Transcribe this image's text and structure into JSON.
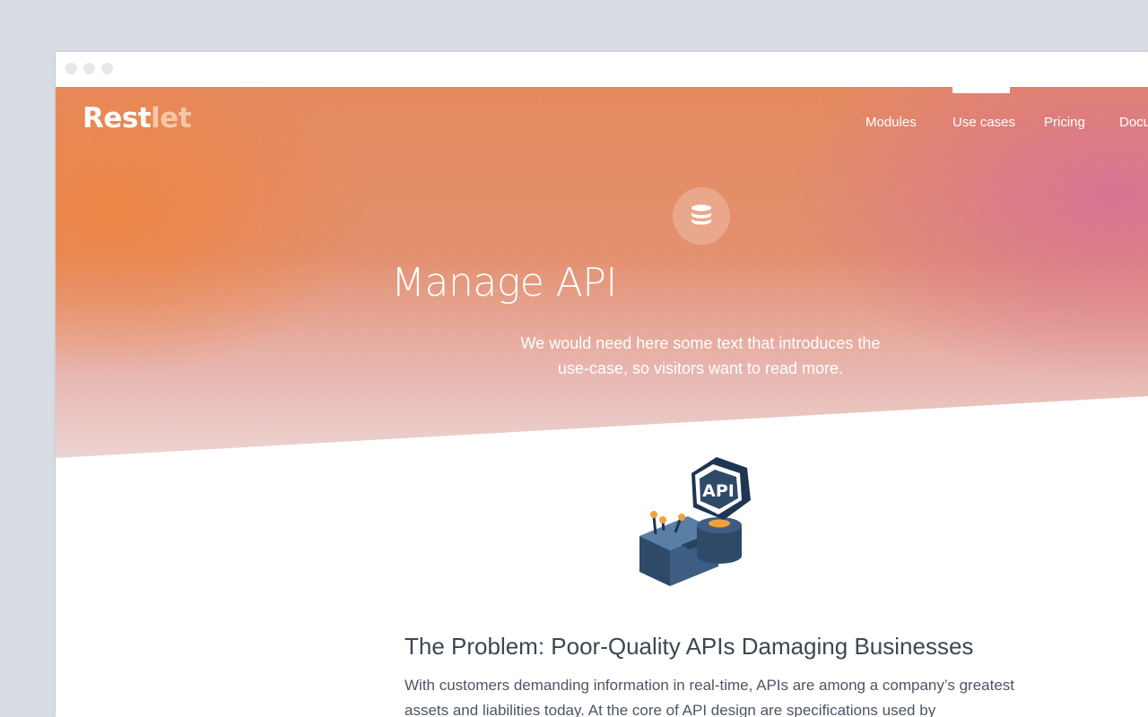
{
  "brand": {
    "logo_main": "Rest",
    "logo_tail": "let"
  },
  "nav": {
    "items": [
      {
        "label": "Modules"
      },
      {
        "label": "Use cases",
        "active": true
      },
      {
        "label": "Pricing"
      },
      {
        "label": "Docu"
      }
    ]
  },
  "hero": {
    "icon": "database-icon",
    "title": "Manage API",
    "subtitle": "We would need here some text that introduces the use-case, so visitors want to read more."
  },
  "illustration": {
    "badge_text": "API"
  },
  "section": {
    "heading": "The Problem: Poor-Quality APIs Damaging Businesses",
    "body": "With customers demanding information in real-time, APIs are among a company’s greatest assets and liabilities today. At the core of API design are specifications used by"
  },
  "colors": {
    "hero_orange": "#ee8440",
    "hero_pink": "#d87296",
    "heading": "#3c4754",
    "body_text": "#4c5664",
    "illustration_navy": "#2f4a69",
    "illustration_accent": "#f0a23a"
  }
}
